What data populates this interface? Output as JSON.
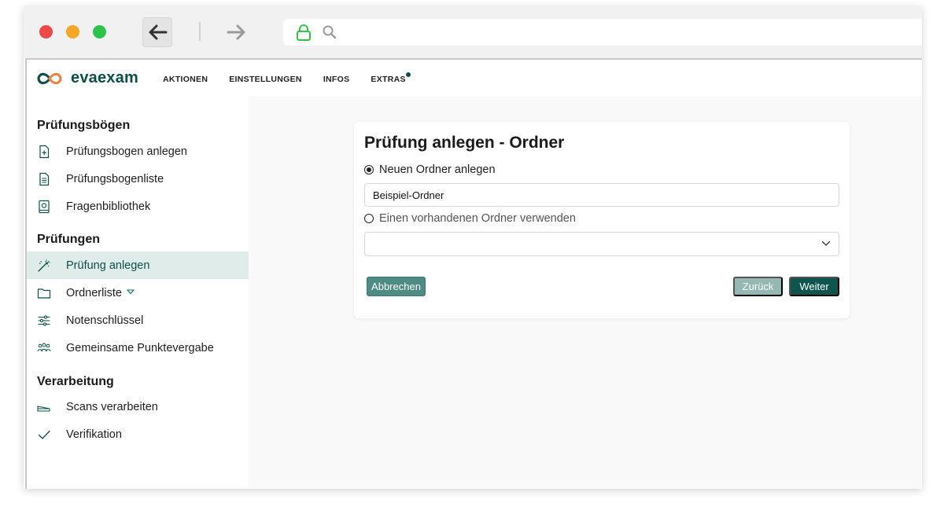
{
  "app": {
    "brand": "evaexam",
    "colors": {
      "primary": "#0e4f4a",
      "accent": "#e8844a",
      "active_bg": "#e0ecea"
    }
  },
  "topnav": {
    "items": [
      {
        "label": "AKTIONEN"
      },
      {
        "label": "EINSTELLUNGEN"
      },
      {
        "label": "INFOS"
      },
      {
        "label": "EXTRAS"
      }
    ]
  },
  "sidebar": {
    "sections": [
      {
        "title": "Prüfungsbögen",
        "items": [
          {
            "label": "Prüfungsbogen anlegen",
            "icon": "file-plus-icon"
          },
          {
            "label": "Prüfungsbogenliste",
            "icon": "file-list-icon"
          },
          {
            "label": "Fragenbibliothek",
            "icon": "book-icon"
          }
        ]
      },
      {
        "title": "Prüfungen",
        "items": [
          {
            "label": "Prüfung anlegen",
            "icon": "magic-wand-icon",
            "active": true
          },
          {
            "label": "Ordnerliste",
            "icon": "folder-icon"
          },
          {
            "label": "Notenschlüssel",
            "icon": "sliders-icon"
          },
          {
            "label": "Gemeinsame Punktevergabe",
            "icon": "users-icon"
          }
        ]
      },
      {
        "title": "Verarbeitung",
        "items": [
          {
            "label": "Scans verarbeiten",
            "icon": "scanner-icon"
          },
          {
            "label": "Verifikation",
            "icon": "check-icon"
          }
        ]
      }
    ]
  },
  "form": {
    "title": "Prüfung anlegen - Ordner",
    "option_new": {
      "label": "Neuen Ordner anlegen",
      "selected": true
    },
    "folder_name_value": "Beispiel-Ordner",
    "option_existing": {
      "label": "Einen vorhandenen Ordner verwenden",
      "selected": false
    },
    "existing_select_value": "",
    "buttons": {
      "cancel": "Abbrechen",
      "back": "Zurück",
      "next": "Weiter"
    }
  }
}
